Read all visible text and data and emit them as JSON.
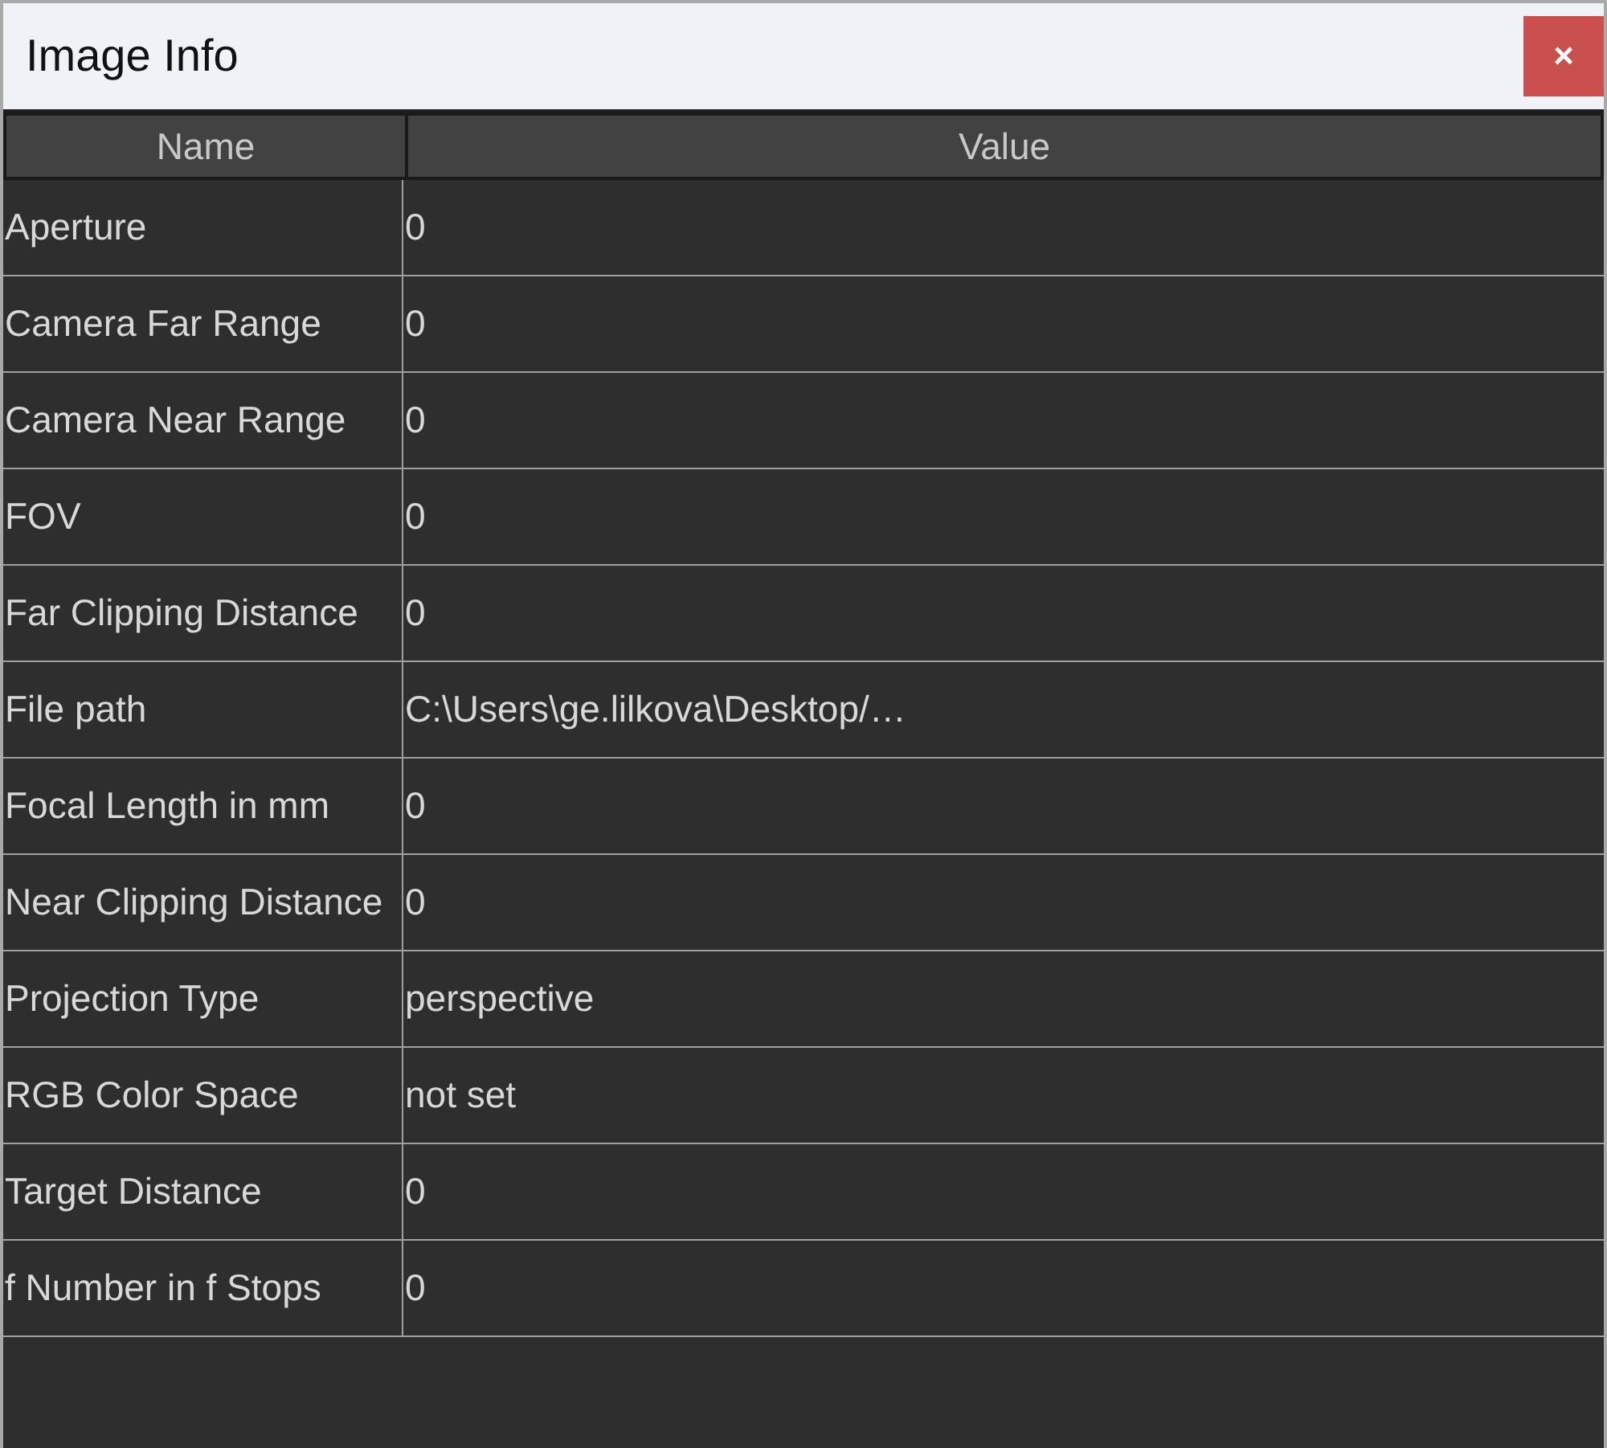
{
  "window": {
    "title": "Image Info",
    "close_label": "×"
  },
  "table": {
    "columns": [
      "Name",
      "Value"
    ],
    "rows": [
      {
        "name": "Aperture",
        "value": "0"
      },
      {
        "name": "Camera Far Range",
        "value": "0"
      },
      {
        "name": "Camera Near Range",
        "value": "0"
      },
      {
        "name": "FOV",
        "value": "0"
      },
      {
        "name": "Far Clipping Distance",
        "value": "0"
      },
      {
        "name": "File path",
        "value": "C:\\Users\\ge.lilkova\\Desktop/…"
      },
      {
        "name": "Focal Length in mm",
        "value": "0"
      },
      {
        "name": "Near Clipping Distance",
        "value": "0"
      },
      {
        "name": "Projection Type",
        "value": "perspective"
      },
      {
        "name": "RGB Color Space",
        "value": "not set"
      },
      {
        "name": "Target Distance",
        "value": "0"
      },
      {
        "name": "f Number in f Stops",
        "value": "0"
      }
    ]
  }
}
